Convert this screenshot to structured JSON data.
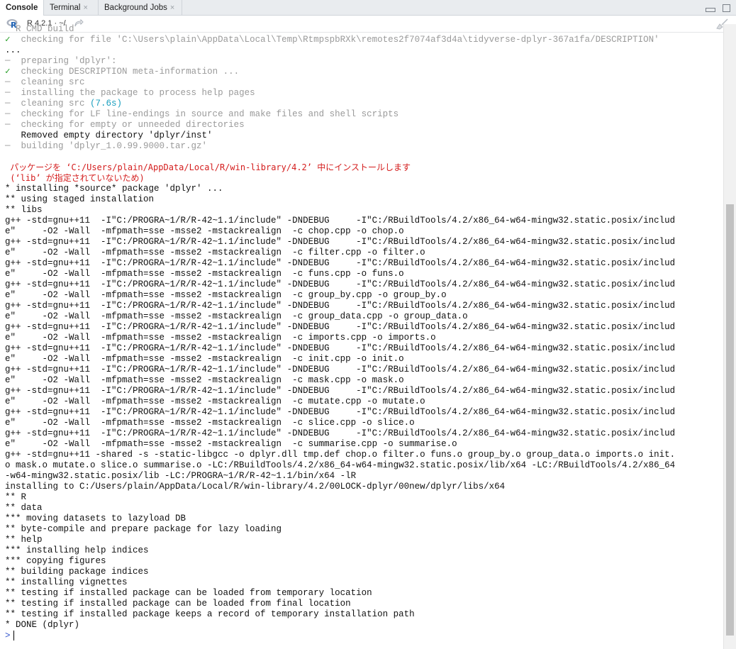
{
  "tabs": [
    {
      "label": "Console",
      "active": true,
      "closable": false
    },
    {
      "label": "Terminal",
      "active": false,
      "closable": true
    },
    {
      "label": "Background Jobs",
      "active": false,
      "closable": true
    }
  ],
  "toolbar": {
    "r_version": "R 4.2.1 · ~/",
    "share_icon": "forward-arrow-icon",
    "clear_icon": "broom-icon"
  },
  "window_controls": {
    "minimize_icon": "minimize-icon",
    "maximize_icon": "maximize-icon"
  },
  "colors": {
    "check": "#2aa02a",
    "muted": "#9a9a9a",
    "timing": "#1a9fbf",
    "message": "#d41d1d",
    "prompt": "#3355cc"
  },
  "console": {
    "lines": [
      {
        "prefix": "",
        "text": "  R CMD build",
        "style": "gray"
      },
      {
        "prefix": "✓",
        "text": "  checking for file 'C:\\Users\\plain\\AppData\\Local\\Temp\\RtmpspbRXk\\remotes2f7074af3d4a\\tidyverse-dplyr-367a1fa/DESCRIPTION'",
        "style": "gray"
      },
      {
        "prefix": "",
        "text": "...",
        "style": "normal"
      },
      {
        "prefix": "─",
        "text": "  preparing 'dplyr':",
        "style": "gray"
      },
      {
        "prefix": "✓",
        "text": "  checking DESCRIPTION meta-information ...",
        "style": "gray"
      },
      {
        "prefix": "─",
        "text": "  cleaning src",
        "style": "gray"
      },
      {
        "prefix": "─",
        "text": "  installing the package to process help pages",
        "style": "gray"
      },
      {
        "prefix": "─",
        "text": "  cleaning src ",
        "extra": "(7.6s)",
        "style": "gray"
      },
      {
        "prefix": "─",
        "text": "  checking for LF line-endings in source and make files and shell scripts",
        "style": "gray"
      },
      {
        "prefix": "─",
        "text": "  checking for empty or unneeded directories",
        "style": "gray"
      },
      {
        "prefix": "",
        "text": "   Removed empty directory 'dplyr/inst'",
        "style": "normal"
      },
      {
        "prefix": "─",
        "text": "  building 'dplyr_1.0.99.9000.tar.gz'",
        "style": "gray"
      },
      {
        "prefix": "",
        "text": "   ",
        "style": "normal"
      },
      {
        "prefix": "",
        "text": " パッケージを ‘C:/Users/plain/AppData/Local/R/win-library/4.2’ 中にインストールします",
        "style": "red"
      },
      {
        "prefix": "",
        "text": " (‘lib’ が指定されていないため)",
        "style": "red"
      },
      {
        "prefix": "",
        "text": "* installing *source* package 'dplyr' ...",
        "style": "normal"
      },
      {
        "prefix": "",
        "text": "** using staged installation",
        "style": "normal"
      },
      {
        "prefix": "",
        "text": "** libs",
        "style": "normal"
      },
      {
        "prefix": "",
        "text": "g++ -std=gnu++11  -I\"C:/PROGRA~1/R/R-42~1.1/include\" -DNDEBUG     -I\"C:/RBuildTools/4.2/x86_64-w64-mingw32.static.posix/includ",
        "style": "normal"
      },
      {
        "prefix": "",
        "text": "e\"     -O2 -Wall  -mfpmath=sse -msse2 -mstackrealign  -c chop.cpp -o chop.o",
        "style": "normal"
      },
      {
        "prefix": "",
        "text": "g++ -std=gnu++11  -I\"C:/PROGRA~1/R/R-42~1.1/include\" -DNDEBUG     -I\"C:/RBuildTools/4.2/x86_64-w64-mingw32.static.posix/includ",
        "style": "normal"
      },
      {
        "prefix": "",
        "text": "e\"     -O2 -Wall  -mfpmath=sse -msse2 -mstackrealign  -c filter.cpp -o filter.o",
        "style": "normal"
      },
      {
        "prefix": "",
        "text": "g++ -std=gnu++11  -I\"C:/PROGRA~1/R/R-42~1.1/include\" -DNDEBUG     -I\"C:/RBuildTools/4.2/x86_64-w64-mingw32.static.posix/includ",
        "style": "normal"
      },
      {
        "prefix": "",
        "text": "e\"     -O2 -Wall  -mfpmath=sse -msse2 -mstackrealign  -c funs.cpp -o funs.o",
        "style": "normal"
      },
      {
        "prefix": "",
        "text": "g++ -std=gnu++11  -I\"C:/PROGRA~1/R/R-42~1.1/include\" -DNDEBUG     -I\"C:/RBuildTools/4.2/x86_64-w64-mingw32.static.posix/includ",
        "style": "normal"
      },
      {
        "prefix": "",
        "text": "e\"     -O2 -Wall  -mfpmath=sse -msse2 -mstackrealign  -c group_by.cpp -o group_by.o",
        "style": "normal"
      },
      {
        "prefix": "",
        "text": "g++ -std=gnu++11  -I\"C:/PROGRA~1/R/R-42~1.1/include\" -DNDEBUG     -I\"C:/RBuildTools/4.2/x86_64-w64-mingw32.static.posix/includ",
        "style": "normal"
      },
      {
        "prefix": "",
        "text": "e\"     -O2 -Wall  -mfpmath=sse -msse2 -mstackrealign  -c group_data.cpp -o group_data.o",
        "style": "normal"
      },
      {
        "prefix": "",
        "text": "g++ -std=gnu++11  -I\"C:/PROGRA~1/R/R-42~1.1/include\" -DNDEBUG     -I\"C:/RBuildTools/4.2/x86_64-w64-mingw32.static.posix/includ",
        "style": "normal"
      },
      {
        "prefix": "",
        "text": "e\"     -O2 -Wall  -mfpmath=sse -msse2 -mstackrealign  -c imports.cpp -o imports.o",
        "style": "normal"
      },
      {
        "prefix": "",
        "text": "g++ -std=gnu++11  -I\"C:/PROGRA~1/R/R-42~1.1/include\" -DNDEBUG     -I\"C:/RBuildTools/4.2/x86_64-w64-mingw32.static.posix/includ",
        "style": "normal"
      },
      {
        "prefix": "",
        "text": "e\"     -O2 -Wall  -mfpmath=sse -msse2 -mstackrealign  -c init.cpp -o init.o",
        "style": "normal"
      },
      {
        "prefix": "",
        "text": "g++ -std=gnu++11  -I\"C:/PROGRA~1/R/R-42~1.1/include\" -DNDEBUG     -I\"C:/RBuildTools/4.2/x86_64-w64-mingw32.static.posix/includ",
        "style": "normal"
      },
      {
        "prefix": "",
        "text": "e\"     -O2 -Wall  -mfpmath=sse -msse2 -mstackrealign  -c mask.cpp -o mask.o",
        "style": "normal"
      },
      {
        "prefix": "",
        "text": "g++ -std=gnu++11  -I\"C:/PROGRA~1/R/R-42~1.1/include\" -DNDEBUG     -I\"C:/RBuildTools/4.2/x86_64-w64-mingw32.static.posix/includ",
        "style": "normal"
      },
      {
        "prefix": "",
        "text": "e\"     -O2 -Wall  -mfpmath=sse -msse2 -mstackrealign  -c mutate.cpp -o mutate.o",
        "style": "normal"
      },
      {
        "prefix": "",
        "text": "g++ -std=gnu++11  -I\"C:/PROGRA~1/R/R-42~1.1/include\" -DNDEBUG     -I\"C:/RBuildTools/4.2/x86_64-w64-mingw32.static.posix/includ",
        "style": "normal"
      },
      {
        "prefix": "",
        "text": "e\"     -O2 -Wall  -mfpmath=sse -msse2 -mstackrealign  -c slice.cpp -o slice.o",
        "style": "normal"
      },
      {
        "prefix": "",
        "text": "g++ -std=gnu++11  -I\"C:/PROGRA~1/R/R-42~1.1/include\" -DNDEBUG     -I\"C:/RBuildTools/4.2/x86_64-w64-mingw32.static.posix/includ",
        "style": "normal"
      },
      {
        "prefix": "",
        "text": "e\"     -O2 -Wall  -mfpmath=sse -msse2 -mstackrealign  -c summarise.cpp -o summarise.o",
        "style": "normal"
      },
      {
        "prefix": "",
        "text": "g++ -std=gnu++11 -shared -s -static-libgcc -o dplyr.dll tmp.def chop.o filter.o funs.o group_by.o group_data.o imports.o init.",
        "style": "normal"
      },
      {
        "prefix": "",
        "text": "o mask.o mutate.o slice.o summarise.o -LC:/RBuildTools/4.2/x86_64-w64-mingw32.static.posix/lib/x64 -LC:/RBuildTools/4.2/x86_64",
        "style": "normal"
      },
      {
        "prefix": "",
        "text": "-w64-mingw32.static.posix/lib -LC:/PROGRA~1/R/R-42~1.1/bin/x64 -lR",
        "style": "normal"
      },
      {
        "prefix": "",
        "text": "installing to C:/Users/plain/AppData/Local/R/win-library/4.2/00LOCK-dplyr/00new/dplyr/libs/x64",
        "style": "normal"
      },
      {
        "prefix": "",
        "text": "** R",
        "style": "normal"
      },
      {
        "prefix": "",
        "text": "** data",
        "style": "normal"
      },
      {
        "prefix": "",
        "text": "*** moving datasets to lazyload DB",
        "style": "normal"
      },
      {
        "prefix": "",
        "text": "** byte-compile and prepare package for lazy loading",
        "style": "normal"
      },
      {
        "prefix": "",
        "text": "** help",
        "style": "normal"
      },
      {
        "prefix": "",
        "text": "*** installing help indices",
        "style": "normal"
      },
      {
        "prefix": "",
        "text": "*** copying figures",
        "style": "normal"
      },
      {
        "prefix": "",
        "text": "** building package indices",
        "style": "normal"
      },
      {
        "prefix": "",
        "text": "** installing vignettes",
        "style": "normal"
      },
      {
        "prefix": "",
        "text": "** testing if installed package can be loaded from temporary location",
        "style": "normal"
      },
      {
        "prefix": "",
        "text": "** testing if installed package can be loaded from final location",
        "style": "normal"
      },
      {
        "prefix": "",
        "text": "** testing if installed package keeps a record of temporary installation path",
        "style": "normal"
      },
      {
        "prefix": "",
        "text": "* DONE (dplyr)",
        "style": "normal"
      }
    ],
    "prompt": ">"
  }
}
